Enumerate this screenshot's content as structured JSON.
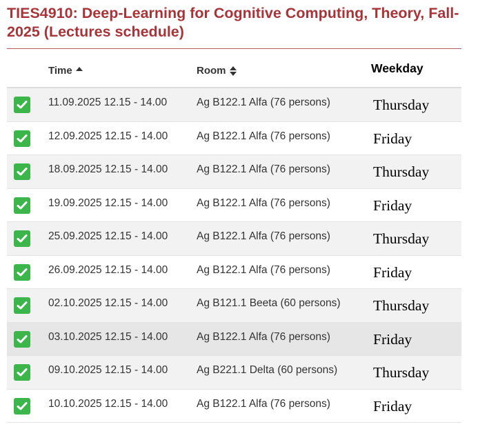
{
  "title": "TIES4910: Deep-Learning for Cognitive Computing, Theory, Fall-2025 (Lectures schedule)",
  "columns": {
    "time": "Time",
    "room": "Room",
    "weekday": "Weekday"
  },
  "colors": {
    "title": "#a73439",
    "check": "#3cb54a",
    "row_stripe": "#f2f2f2"
  },
  "rows": [
    {
      "time": "11.09.2025 12.15 - 14.00",
      "room": "Ag B122.1 Alfa (76 persons)",
      "weekday": "Thursday"
    },
    {
      "time": "12.09.2025 12.15 - 14.00",
      "room": "Ag B122.1 Alfa (76 persons)",
      "weekday": "Friday"
    },
    {
      "time": "18.09.2025 12.15 - 14.00",
      "room": "Ag B122.1 Alfa (76 persons)",
      "weekday": "Thursday"
    },
    {
      "time": "19.09.2025 12.15 - 14.00",
      "room": "Ag B122.1 Alfa (76 persons)",
      "weekday": "Friday"
    },
    {
      "time": "25.09.2025 12.15 - 14.00",
      "room": "Ag B122.1 Alfa (76 persons)",
      "weekday": "Thursday"
    },
    {
      "time": "26.09.2025 12.15 - 14.00",
      "room": "Ag B122.1 Alfa (76 persons)",
      "weekday": "Friday"
    },
    {
      "time": "02.10.2025 12.15 - 14.00",
      "room": "Ag B121.1 Beeta (60 persons)",
      "weekday": "Thursday"
    },
    {
      "time": "03.10.2025 12.15 - 14.00",
      "room": "Ag B122.1 Alfa (76 persons)",
      "weekday": "Friday"
    },
    {
      "time": "09.10.2025 12.15 - 14.00",
      "room": "Ag B221.1 Delta (60 persons)",
      "weekday": "Thursday"
    },
    {
      "time": "10.10.2025 12.15 - 14.00",
      "room": "Ag B122.1 Alfa (76 persons)",
      "weekday": "Friday"
    }
  ]
}
